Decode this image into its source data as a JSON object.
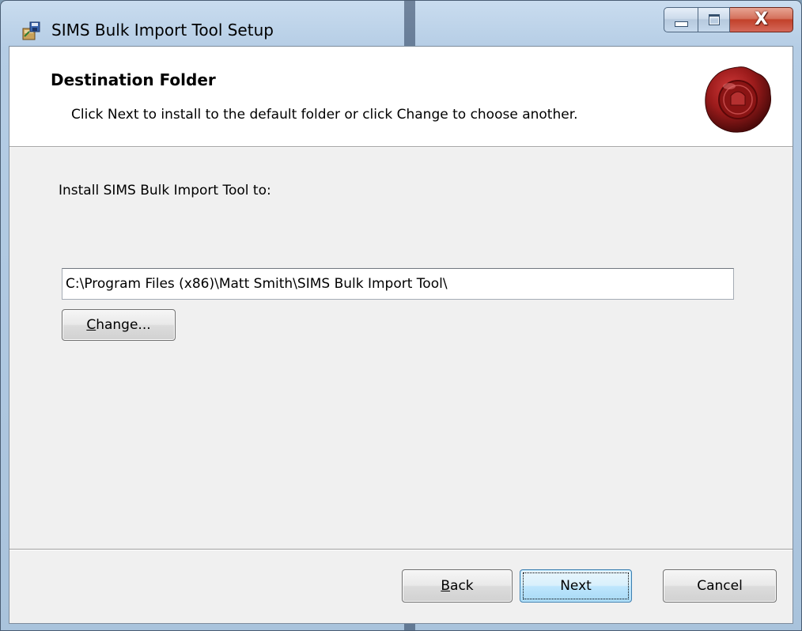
{
  "window": {
    "title": "SIMS Bulk Import Tool Setup",
    "controls": {
      "minimize": "minimize",
      "maximize": "maximize",
      "close": "X"
    }
  },
  "header": {
    "title": "Destination Folder",
    "subtitle": "Click Next to install to the default folder or click Change to choose another."
  },
  "body": {
    "install_label": "Install SIMS Bulk Import Tool to:",
    "install_path": "C:\\Program Files (x86)\\Matt Smith\\SIMS Bulk Import Tool\\",
    "change_button": {
      "accel": "C",
      "rest": "hange..."
    }
  },
  "footer": {
    "back_button": {
      "accel": "B",
      "rest": "ack"
    },
    "next_button": "Next",
    "cancel_button": "Cancel"
  },
  "icons": {
    "app": "installer-icon",
    "header": "wax-seal-icon"
  },
  "colors": {
    "seal": "#9b1b1b",
    "dialog_bg": "#f0f0f0",
    "header_bg": "#ffffff",
    "default_button_border": "#3c7fb1"
  }
}
